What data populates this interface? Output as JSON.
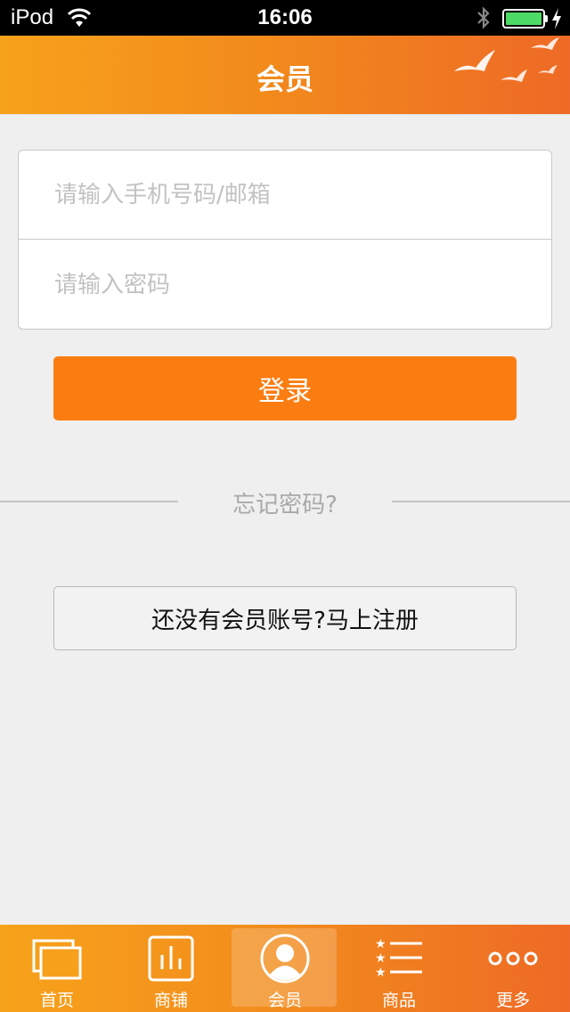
{
  "status_bar": {
    "carrier": "iPod",
    "time": "16:06"
  },
  "header": {
    "title": "会员"
  },
  "login_form": {
    "account_placeholder": "请输入手机号码/邮箱",
    "password_placeholder": "请输入密码",
    "account_value": "",
    "password_value": "",
    "login_label": "登录"
  },
  "forgot_password_label": "忘记密码?",
  "register_label": "还没有会员账号?马上注册",
  "tabbar": {
    "active_index": 2,
    "items": [
      {
        "label": "首页",
        "icon": "home-icon"
      },
      {
        "label": "商铺",
        "icon": "store-chart-icon"
      },
      {
        "label": "会员",
        "icon": "member-avatar-icon"
      },
      {
        "label": "商品",
        "icon": "star-list-icon"
      },
      {
        "label": "更多",
        "icon": "more-dots-icon"
      }
    ]
  },
  "colors": {
    "accent": "#fb7d12",
    "header_gradient_start": "#f7a21b",
    "header_gradient_end": "#ee6a26",
    "background": "#efefef",
    "battery_fill": "#4cd964"
  }
}
